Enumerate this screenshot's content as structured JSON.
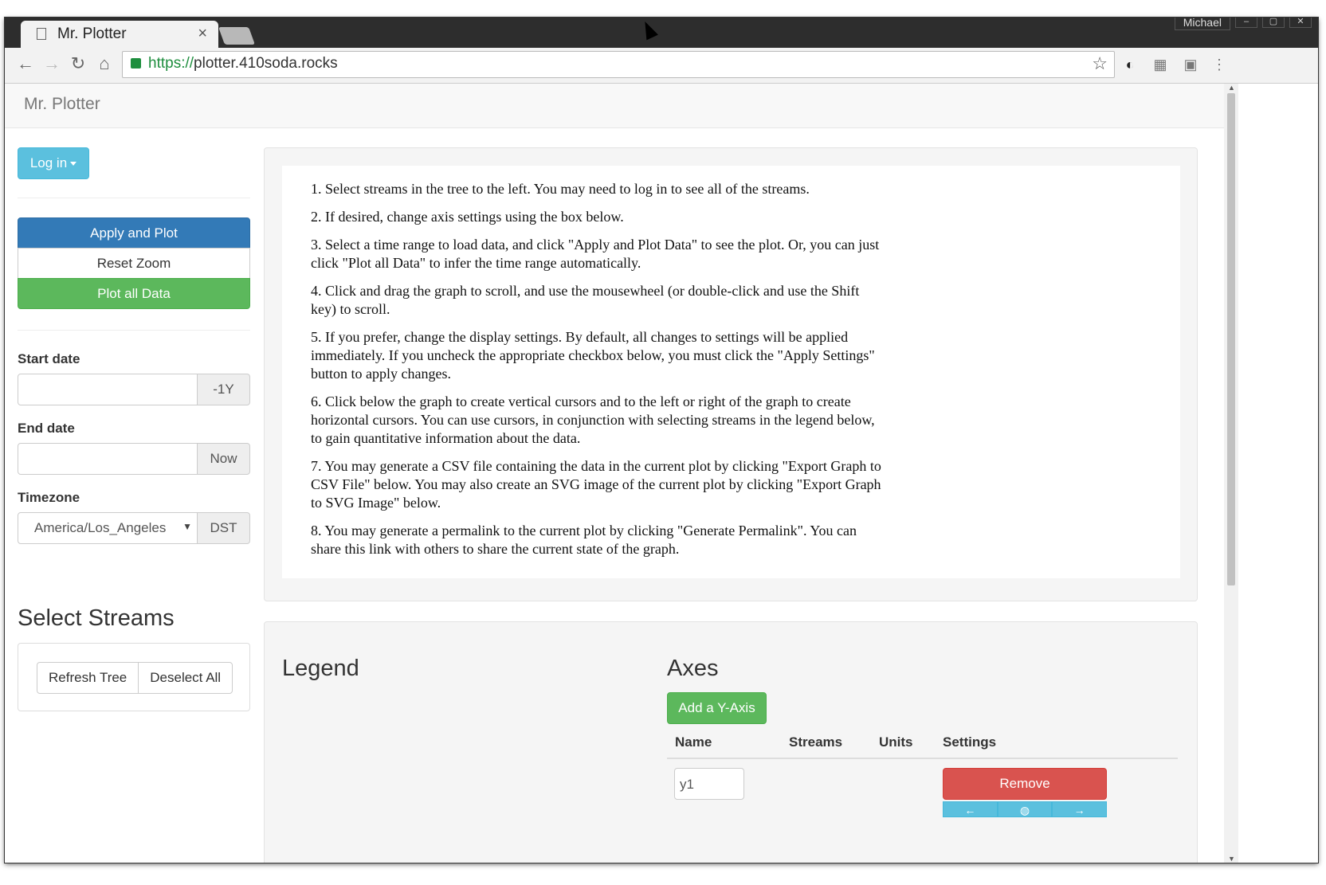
{
  "browser": {
    "tab_title": "Mr. Plotter",
    "tab_close": "×",
    "url_scheme": "https://",
    "url_host": "plotter.410soda.rocks",
    "user": "Michael"
  },
  "navbar": {
    "brand": "Mr. Plotter"
  },
  "sidebar": {
    "login_label": "Log in",
    "apply_label": "Apply and Plot",
    "reset_label": "Reset Zoom",
    "plot_all_label": "Plot all Data",
    "start_date_label": "Start date",
    "start_addon": "-1Y",
    "end_date_label": "End date",
    "end_addon": "Now",
    "timezone_label": "Timezone",
    "timezone_value": "America/Los_Angeles",
    "timezone_addon": "DST",
    "streams_heading": "Select Streams",
    "refresh_label": "Refresh Tree",
    "deselect_label": "Deselect All"
  },
  "instructions": [
    "1. Select streams in the tree to the left. You may need to log in to see all of the streams.",
    "2. If desired, change axis settings using the box below.",
    "3. Select a time range to load data, and click \"Apply and Plot Data\" to see the plot. Or, you can just click \"Plot all Data\" to infer the time range automatically.",
    "4. Click and drag the graph to scroll, and use the mousewheel (or double-click and use the Shift key) to scroll.",
    "5. If you prefer, change the display settings. By default, all changes to settings will be applied immediately. If you uncheck the appropriate checkbox below, you must click the \"Apply Settings\" button to apply changes.",
    "6. Click below the graph to create vertical cursors and to the left or right of the graph to create horizontal cursors. You can use cursors, in conjunction with selecting streams in the legend below, to gain quantitative information about the data.",
    "7. You may generate a CSV file containing the data in the current plot by clicking \"Export Graph to CSV File\" below. You may also create an SVG image of the current plot by clicking \"Export Graph to SVG Image\" below.",
    "8. You may generate a permalink to the current plot by clicking \"Generate Permalink\". You can share this link with others to share the current state of the graph."
  ],
  "legend": {
    "heading": "Legend"
  },
  "axes": {
    "heading": "Axes",
    "add_label": "Add a Y-Axis",
    "columns": [
      "Name",
      "Streams",
      "Units",
      "Settings"
    ],
    "rows": [
      {
        "name": "y1",
        "remove_label": "Remove"
      }
    ]
  }
}
